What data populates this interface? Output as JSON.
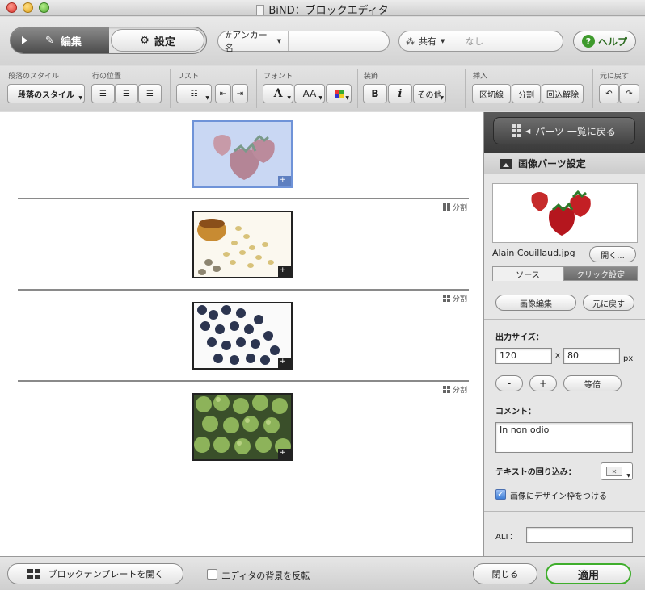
{
  "window": {
    "title": "BiND：ブロックエディタ"
  },
  "mode": {
    "edit_label": "編集",
    "settings_label": "設定"
  },
  "anchor": {
    "label": "#アンカー名",
    "value": ""
  },
  "share": {
    "label": "共有",
    "value": "なし"
  },
  "help": {
    "label": "ヘルプ"
  },
  "toolbar": {
    "groups": {
      "para_style": "段落のスタイル",
      "line_pos": "行の位置",
      "list": "リスト",
      "font": "フォント",
      "decoration": "装飾",
      "insert": "挿入",
      "undo": "元に戻す"
    },
    "para_style_button": "段落のスタイル",
    "bold": "B",
    "italic": "i",
    "other": "その他",
    "font_a": "A",
    "font_aa": "AA",
    "section_break": "区切線",
    "split": "分割",
    "unwrap": "回込解除"
  },
  "canvas": {
    "split_label": "分割",
    "blocks": [
      {
        "image": "strawberries",
        "selected": true
      },
      {
        "image": "grains",
        "selected": false
      },
      {
        "image": "blueberries",
        "selected": false
      },
      {
        "image": "limes",
        "selected": false
      }
    ]
  },
  "panel": {
    "back_label": "パーツ 一覧に戻る",
    "title": "画像パーツ設定",
    "filename": "Alain Couillaud.jpg",
    "open_button": "開く...",
    "tab_source": "ソース",
    "tab_click": "クリック設定",
    "edit_image_button": "画像編集",
    "revert_button": "元に戻す",
    "output_size_label": "出力サイズ：",
    "width": "120",
    "height": "80",
    "x_label": "x",
    "unit": "px",
    "minus": "-",
    "plus": "+",
    "actual_size": "等倍",
    "comment_label": "コメント：",
    "comment_value": "In non odio",
    "wrap_label": "テキストの回り込み：",
    "design_frame_label": "画像にデザイン枠をつける",
    "design_frame_checked": true,
    "alt_label": "ALT：",
    "alt_value": ""
  },
  "bottom": {
    "template_button": "ブロックテンプレートを開く",
    "invert_bg_label": "エディタの背景を反転",
    "close_button": "閉じる",
    "apply_button": "適用"
  },
  "colors": {
    "apply_border": "#3fae2c",
    "selection": "#6f93d8",
    "help_green": "#3e9a2c"
  }
}
